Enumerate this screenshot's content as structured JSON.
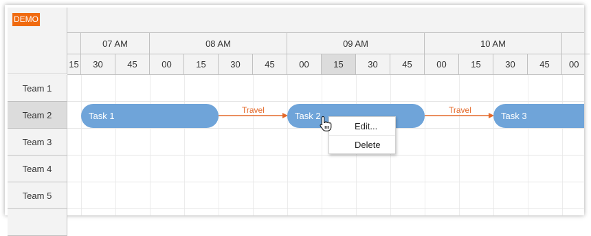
{
  "badge": "DEMO",
  "hours": [
    "07 AM",
    "08 AM",
    "09 AM",
    "10 AM"
  ],
  "minutes": [
    "15",
    "30",
    "45",
    "00",
    "15",
    "30",
    "45",
    "00",
    "15",
    "30",
    "45",
    "00",
    "15",
    "30",
    "45",
    "00"
  ],
  "rows": [
    "Team 1",
    "Team 2",
    "Team 3",
    "Team 4",
    "Team 5"
  ],
  "tasks": [
    {
      "label": "Task 1"
    },
    {
      "label": "Task 2"
    },
    {
      "label": "Task 3"
    }
  ],
  "links": [
    {
      "label": "Travel"
    },
    {
      "label": "Travel"
    }
  ],
  "context_menu": {
    "edit": "Edit...",
    "delete": "Delete"
  },
  "colors": {
    "task": "#6fa4d9",
    "link": "#e4692a",
    "badge": "#f06a0f"
  },
  "cursor_icon": "hand-pointer-icon"
}
